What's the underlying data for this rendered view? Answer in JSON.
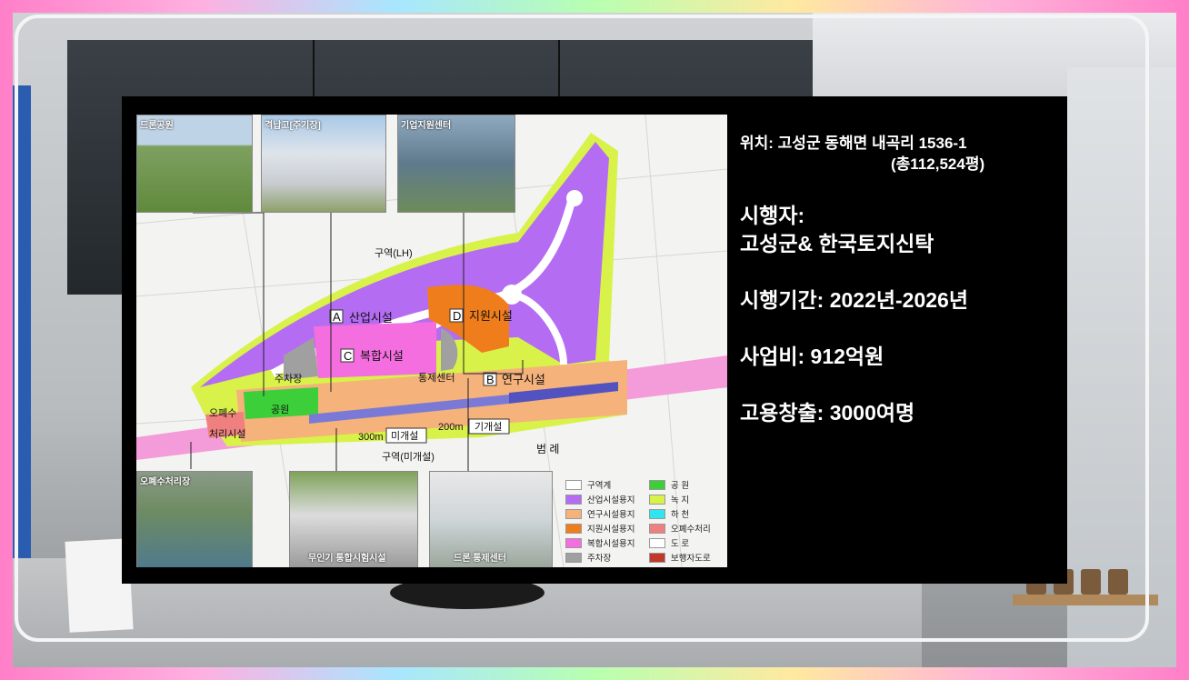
{
  "info": {
    "location_line1": "위치: 고성군 동해면 내곡리 1536-1",
    "location_line2": "(총112,524평)",
    "operator_label": "시행자:",
    "operator_value": "고성군& 한국토지신탁",
    "period": "시행기간: 2022년-2026년",
    "cost": "사업비: 912억원",
    "jobs": "고용창출: 3000여명"
  },
  "map": {
    "photos": {
      "drone_park": "드론공원",
      "hangar": "격납고[주기장]",
      "support_center": "기업지원센터",
      "sewage": "오폐수처리장",
      "test_facility": "무인기 통합시험시설",
      "control_center": "드론 통제센터"
    },
    "zones": {
      "A_letter": "A",
      "A_label": "산업시설",
      "B_letter": "B",
      "B_label": "연구시설",
      "C_letter": "C",
      "C_label": "복합시설",
      "D_letter": "D",
      "D_label": "지원시설"
    },
    "labels": {
      "district_top": "구역(LH)",
      "parking": "주차장",
      "park": "공원",
      "control": "통제센터",
      "sewage_line1": "오폐수",
      "sewage_line2": "처리시설",
      "runway_300": "300m",
      "runway_unpaved": "미개설",
      "runway_200": "200m",
      "runway_paved": "기개설",
      "district_bottom": "구역(미개설)",
      "beomrye": "범 례"
    },
    "legend": [
      {
        "label": "구역계",
        "color": "#ffffff"
      },
      {
        "label": "산업시설용지",
        "color": "#b46cf2"
      },
      {
        "label": "연구시설용지",
        "color": "#f5b27a"
      },
      {
        "label": "지원시설용지",
        "color": "#f07d1c"
      },
      {
        "label": "복합시설용지",
        "color": "#f46ee0"
      },
      {
        "label": "주차장",
        "color": "#a0a0a0"
      },
      {
        "label": "공 원",
        "color": "#3ccf3a"
      },
      {
        "label": "녹 지",
        "color": "#d8f24a"
      },
      {
        "label": "하 천",
        "color": "#2ee6f0"
      },
      {
        "label": "오폐수처리",
        "color": "#f08080"
      },
      {
        "label": "도 로",
        "color": "#ffffff"
      },
      {
        "label": "보행자도로",
        "color": "#c0392b"
      }
    ]
  }
}
